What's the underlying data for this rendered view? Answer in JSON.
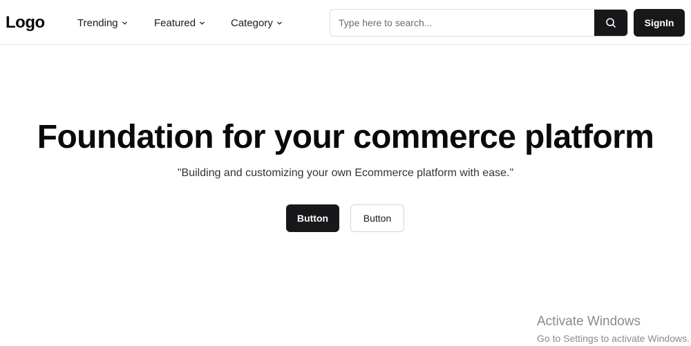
{
  "navbar": {
    "logo": "Logo",
    "links": [
      {
        "label": "Trending"
      },
      {
        "label": "Featured"
      },
      {
        "label": "Category"
      }
    ],
    "search": {
      "placeholder": "Type here to search...",
      "value": "",
      "button_icon": "search-icon"
    },
    "signin_label": "SignIn"
  },
  "hero": {
    "title": "Foundation for your commerce platform",
    "subtitle": "\"Building and customizing your own Ecommerce platform with ease.\"",
    "primary_button": "Button",
    "secondary_button": "Button"
  },
  "os_watermark": {
    "title": "Activate Windows",
    "subtitle": "Go to Settings to activate Windows."
  },
  "colors": {
    "primary": "#18181b",
    "border": "#e5e5e5",
    "text": "#0a0a0a",
    "watermark": "#8a8a8a"
  }
}
